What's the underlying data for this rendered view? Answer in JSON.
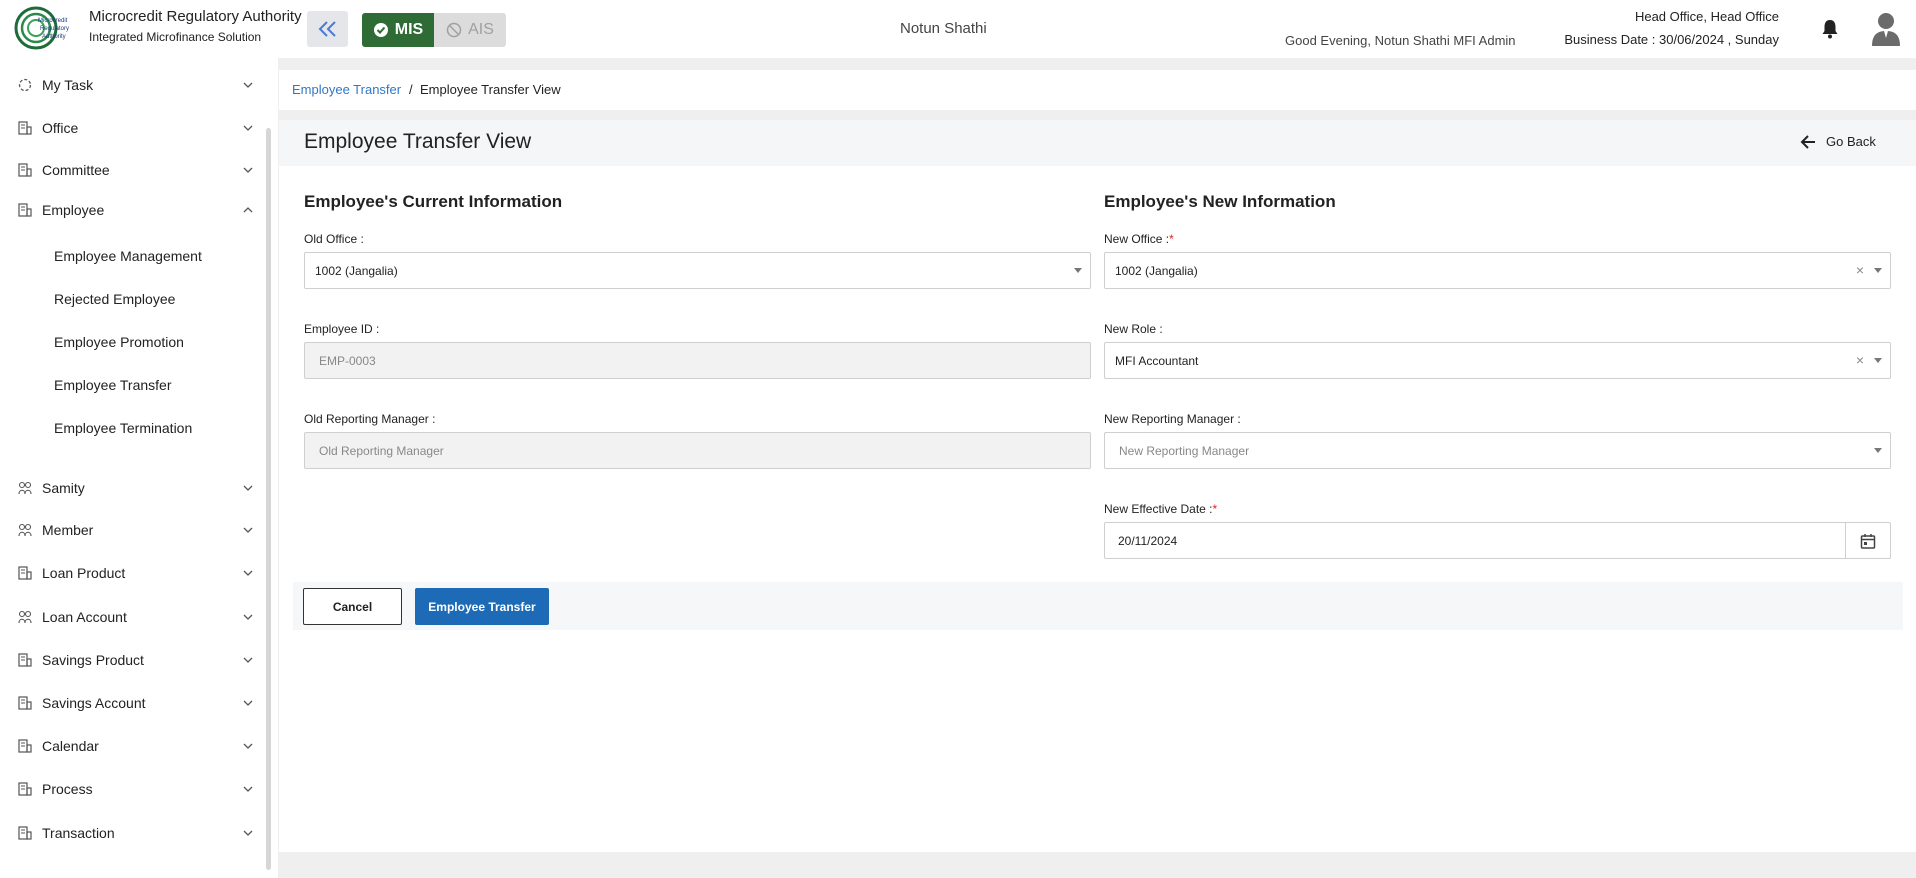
{
  "header": {
    "brand_title": "Microcredit Regulatory Authority",
    "brand_subtitle": "Integrated Microfinance Solution",
    "logo_text": [
      "Microcredit",
      "Regulatory",
      "Authority"
    ],
    "mode_mis": "MIS",
    "mode_ais": "AIS",
    "org_name": "Notun Shathi",
    "greeting": "Good Evening, Notun Shathi MFI Admin",
    "office": "Head Office, Head Office",
    "business_date": "Business Date : 30/06/2024 , Sunday"
  },
  "sidebar": {
    "items": [
      {
        "label": "My Task",
        "icon": "task-icon"
      },
      {
        "label": "Office",
        "icon": "office-icon"
      },
      {
        "label": "Committee",
        "icon": "committee-icon"
      },
      {
        "label": "Employee",
        "icon": "employee-icon"
      },
      {
        "label": "Samity",
        "icon": "samity-icon"
      },
      {
        "label": "Member",
        "icon": "member-icon"
      },
      {
        "label": "Loan Product",
        "icon": "loan-product-icon"
      },
      {
        "label": "Loan Account",
        "icon": "loan-account-icon"
      },
      {
        "label": "Savings Product",
        "icon": "savings-product-icon"
      },
      {
        "label": "Savings Account",
        "icon": "savings-account-icon"
      },
      {
        "label": "Calendar",
        "icon": "calendar-icon"
      },
      {
        "label": "Process",
        "icon": "process-icon"
      },
      {
        "label": "Transaction",
        "icon": "transaction-icon"
      }
    ],
    "employee_sub": [
      "Employee Management",
      "Rejected Employee",
      "Employee Promotion",
      "Employee Transfer",
      "Employee Termination"
    ]
  },
  "breadcrumb": {
    "parent": "Employee Transfer",
    "separator": "/",
    "current": "Employee Transfer View"
  },
  "page": {
    "title": "Employee Transfer View",
    "go_back": "Go Back"
  },
  "current_info": {
    "title": "Employee's Current Information",
    "old_office_label": "Old Office :",
    "old_office_value": "1002 (Jangalia)",
    "employee_id_label": "Employee ID :",
    "employee_id_value": "EMP-0003",
    "old_manager_label": "Old Reporting Manager :",
    "old_manager_placeholder": "Old Reporting Manager"
  },
  "new_info": {
    "title": "Employee's New Information",
    "new_office_label": "New Office :",
    "new_office_value": "1002 (Jangalia)",
    "new_role_label": "New Role :",
    "new_role_value": "MFI Accountant",
    "new_manager_label": "New Reporting Manager :",
    "new_manager_placeholder": "New Reporting Manager",
    "effective_date_label": "New Effective Date :",
    "effective_date_value": "20/11/2024",
    "required_mark": "*",
    "clear_glyph": "×"
  },
  "actions": {
    "cancel": "Cancel",
    "submit": "Employee Transfer"
  },
  "colors": {
    "mis_green": "#2e6b35",
    "primary_blue": "#1d6bb6",
    "link_blue": "#2f77c8",
    "required_red": "#e02020"
  }
}
